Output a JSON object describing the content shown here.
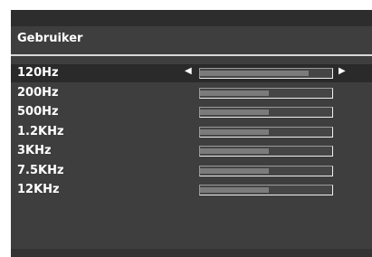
{
  "menu": {
    "title": "Gebruiker",
    "selected_index": 0,
    "arrows": {
      "left": "◀",
      "right": "▶"
    },
    "bands": [
      {
        "label": "120Hz",
        "level": 0.82
      },
      {
        "label": "200Hz",
        "level": 0.52
      },
      {
        "label": "500Hz",
        "level": 0.52
      },
      {
        "label": "1.2KHz",
        "level": 0.52
      },
      {
        "label": "3KHz",
        "level": 0.52
      },
      {
        "label": "7.5KHz",
        "level": 0.52
      },
      {
        "label": "12KHz",
        "level": 0.52
      }
    ]
  }
}
